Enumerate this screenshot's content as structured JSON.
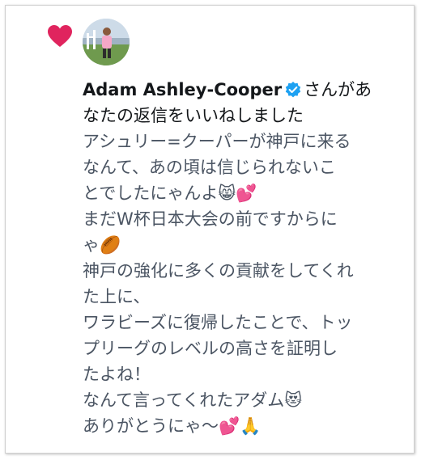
{
  "notification": {
    "user_name": "Adam Ashley-Cooper",
    "action_line1": "さんがあ",
    "action_line2": "なたの返信をいいねしました"
  },
  "tweet": {
    "lines": [
      "アシュリー=クーパーが神戸に来る",
      "なんて、あの頃は信じられないこ",
      "とでしたにゃんよ😸💕",
      "まだW杯日本大会の前ですからに",
      "ゃ🏉",
      "神戸の強化に多くの貢献をしてくれ",
      "た上に、",
      "ワラビーズに復帰したことで、トッ",
      "プリーグのレベルの高さを証明し",
      "たよね！",
      "なんて言ってくれたアダム😻",
      "ありがとうにゃ〜💕🙏"
    ]
  },
  "colors": {
    "heart": "#e0245e",
    "verified": "#1da1f2",
    "tweet_text": "#4b5563",
    "name_text": "#14171a"
  },
  "icons": {
    "like": "heart-icon",
    "verified": "verified-badge-icon"
  }
}
